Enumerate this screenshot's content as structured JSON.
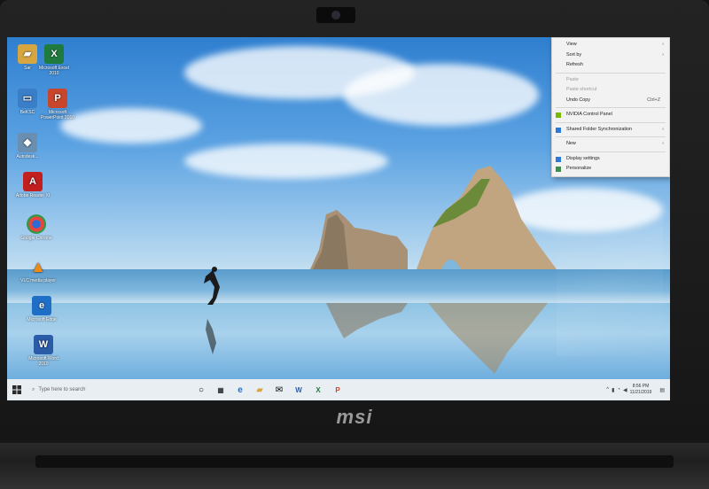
{
  "brand": {
    "name": "msi"
  },
  "desktop": {
    "icons": [
      {
        "label": "Sar",
        "icon": "folder-icon",
        "color": "#d8a640"
      },
      {
        "label": "Microsoft Excel 2010",
        "icon": "excel-icon",
        "color": "#1f7a3e"
      },
      {
        "label": "BeKSC",
        "icon": "computer-icon",
        "color": "#3a7ec8"
      },
      {
        "label": "Microsoft PowerPoint 2010",
        "icon": "powerpoint-icon",
        "color": "#c8462b"
      },
      {
        "label": "Autodesk...",
        "icon": "app-icon",
        "color": "#6a8fb0"
      },
      {
        "label": "Adobe Reader XI",
        "icon": "acrobat-icon",
        "color": "#c21f1f"
      },
      {
        "label": "Google Chrome",
        "icon": "chrome-icon",
        "color": "#2f9a4a"
      },
      {
        "label": "VLC media player",
        "icon": "vlc-icon",
        "color": "#f08a14"
      },
      {
        "label": "Microsoft Edge",
        "icon": "edge-icon",
        "color": "#1f6fc7"
      },
      {
        "label": "Microsoft Word 2010",
        "icon": "word-icon",
        "color": "#2b5ca8"
      }
    ]
  },
  "context_menu": {
    "items": [
      {
        "label": "View",
        "arrow": "›",
        "disabled": false
      },
      {
        "label": "Sort by",
        "arrow": "›",
        "disabled": false
      },
      {
        "label": "Refresh",
        "disabled": false
      },
      {
        "sep": true
      },
      {
        "label": "Paste",
        "disabled": true
      },
      {
        "label": "Paste shortcut",
        "disabled": true
      },
      {
        "label": "Undo Copy",
        "shortcut": "Ctrl+Z",
        "disabled": false
      },
      {
        "sep": true
      },
      {
        "label": "NVIDIA Control Panel",
        "icon": "nvidia-icon",
        "disabled": false
      },
      {
        "sep": true
      },
      {
        "label": "Shared Folder Synchronization",
        "icon": "sync-icon",
        "arrow": "›",
        "disabled": false
      },
      {
        "sep": true
      },
      {
        "label": "New",
        "arrow": "›",
        "disabled": false
      },
      {
        "sep": true
      },
      {
        "label": "Display settings",
        "icon": "display-icon",
        "disabled": false
      },
      {
        "label": "Personalize",
        "icon": "personalize-icon",
        "disabled": false
      }
    ]
  },
  "taskbar": {
    "search_placeholder": "Type here to search",
    "clock_time": "8:56 PM",
    "clock_date": "11/21/2019"
  }
}
